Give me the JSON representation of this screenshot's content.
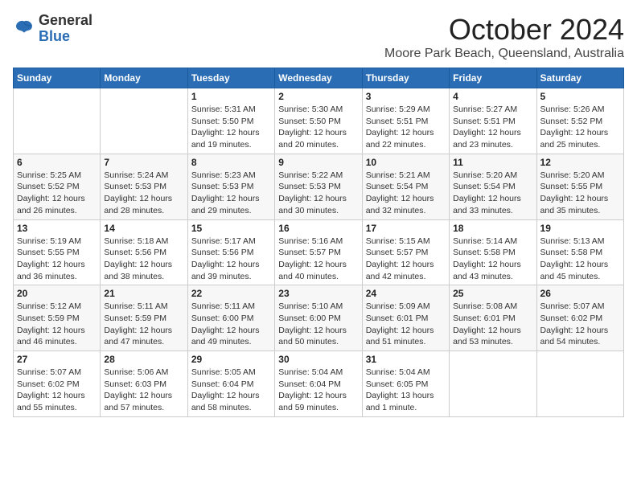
{
  "logo": {
    "general": "General",
    "blue": "Blue"
  },
  "title": "October 2024",
  "location": "Moore Park Beach, Queensland, Australia",
  "days_header": [
    "Sunday",
    "Monday",
    "Tuesday",
    "Wednesday",
    "Thursday",
    "Friday",
    "Saturday"
  ],
  "weeks": [
    [
      {
        "day": "",
        "info": ""
      },
      {
        "day": "",
        "info": ""
      },
      {
        "day": "1",
        "sunrise": "5:31 AM",
        "sunset": "5:50 PM",
        "daylight": "12 hours and 19 minutes."
      },
      {
        "day": "2",
        "sunrise": "5:30 AM",
        "sunset": "5:50 PM",
        "daylight": "12 hours and 20 minutes."
      },
      {
        "day": "3",
        "sunrise": "5:29 AM",
        "sunset": "5:51 PM",
        "daylight": "12 hours and 22 minutes."
      },
      {
        "day": "4",
        "sunrise": "5:27 AM",
        "sunset": "5:51 PM",
        "daylight": "12 hours and 23 minutes."
      },
      {
        "day": "5",
        "sunrise": "5:26 AM",
        "sunset": "5:52 PM",
        "daylight": "12 hours and 25 minutes."
      }
    ],
    [
      {
        "day": "6",
        "sunrise": "5:25 AM",
        "sunset": "5:52 PM",
        "daylight": "12 hours and 26 minutes."
      },
      {
        "day": "7",
        "sunrise": "5:24 AM",
        "sunset": "5:53 PM",
        "daylight": "12 hours and 28 minutes."
      },
      {
        "day": "8",
        "sunrise": "5:23 AM",
        "sunset": "5:53 PM",
        "daylight": "12 hours and 29 minutes."
      },
      {
        "day": "9",
        "sunrise": "5:22 AM",
        "sunset": "5:53 PM",
        "daylight": "12 hours and 30 minutes."
      },
      {
        "day": "10",
        "sunrise": "5:21 AM",
        "sunset": "5:54 PM",
        "daylight": "12 hours and 32 minutes."
      },
      {
        "day": "11",
        "sunrise": "5:20 AM",
        "sunset": "5:54 PM",
        "daylight": "12 hours and 33 minutes."
      },
      {
        "day": "12",
        "sunrise": "5:20 AM",
        "sunset": "5:55 PM",
        "daylight": "12 hours and 35 minutes."
      }
    ],
    [
      {
        "day": "13",
        "sunrise": "5:19 AM",
        "sunset": "5:55 PM",
        "daylight": "12 hours and 36 minutes."
      },
      {
        "day": "14",
        "sunrise": "5:18 AM",
        "sunset": "5:56 PM",
        "daylight": "12 hours and 38 minutes."
      },
      {
        "day": "15",
        "sunrise": "5:17 AM",
        "sunset": "5:56 PM",
        "daylight": "12 hours and 39 minutes."
      },
      {
        "day": "16",
        "sunrise": "5:16 AM",
        "sunset": "5:57 PM",
        "daylight": "12 hours and 40 minutes."
      },
      {
        "day": "17",
        "sunrise": "5:15 AM",
        "sunset": "5:57 PM",
        "daylight": "12 hours and 42 minutes."
      },
      {
        "day": "18",
        "sunrise": "5:14 AM",
        "sunset": "5:58 PM",
        "daylight": "12 hours and 43 minutes."
      },
      {
        "day": "19",
        "sunrise": "5:13 AM",
        "sunset": "5:58 PM",
        "daylight": "12 hours and 45 minutes."
      }
    ],
    [
      {
        "day": "20",
        "sunrise": "5:12 AM",
        "sunset": "5:59 PM",
        "daylight": "12 hours and 46 minutes."
      },
      {
        "day": "21",
        "sunrise": "5:11 AM",
        "sunset": "5:59 PM",
        "daylight": "12 hours and 47 minutes."
      },
      {
        "day": "22",
        "sunrise": "5:11 AM",
        "sunset": "6:00 PM",
        "daylight": "12 hours and 49 minutes."
      },
      {
        "day": "23",
        "sunrise": "5:10 AM",
        "sunset": "6:00 PM",
        "daylight": "12 hours and 50 minutes."
      },
      {
        "day": "24",
        "sunrise": "5:09 AM",
        "sunset": "6:01 PM",
        "daylight": "12 hours and 51 minutes."
      },
      {
        "day": "25",
        "sunrise": "5:08 AM",
        "sunset": "6:01 PM",
        "daylight": "12 hours and 53 minutes."
      },
      {
        "day": "26",
        "sunrise": "5:07 AM",
        "sunset": "6:02 PM",
        "daylight": "12 hours and 54 minutes."
      }
    ],
    [
      {
        "day": "27",
        "sunrise": "5:07 AM",
        "sunset": "6:02 PM",
        "daylight": "12 hours and 55 minutes."
      },
      {
        "day": "28",
        "sunrise": "5:06 AM",
        "sunset": "6:03 PM",
        "daylight": "12 hours and 57 minutes."
      },
      {
        "day": "29",
        "sunrise": "5:05 AM",
        "sunset": "6:04 PM",
        "daylight": "12 hours and 58 minutes."
      },
      {
        "day": "30",
        "sunrise": "5:04 AM",
        "sunset": "6:04 PM",
        "daylight": "12 hours and 59 minutes."
      },
      {
        "day": "31",
        "sunrise": "5:04 AM",
        "sunset": "6:05 PM",
        "daylight": "13 hours and 1 minute."
      },
      {
        "day": "",
        "info": ""
      },
      {
        "day": "",
        "info": ""
      }
    ]
  ]
}
